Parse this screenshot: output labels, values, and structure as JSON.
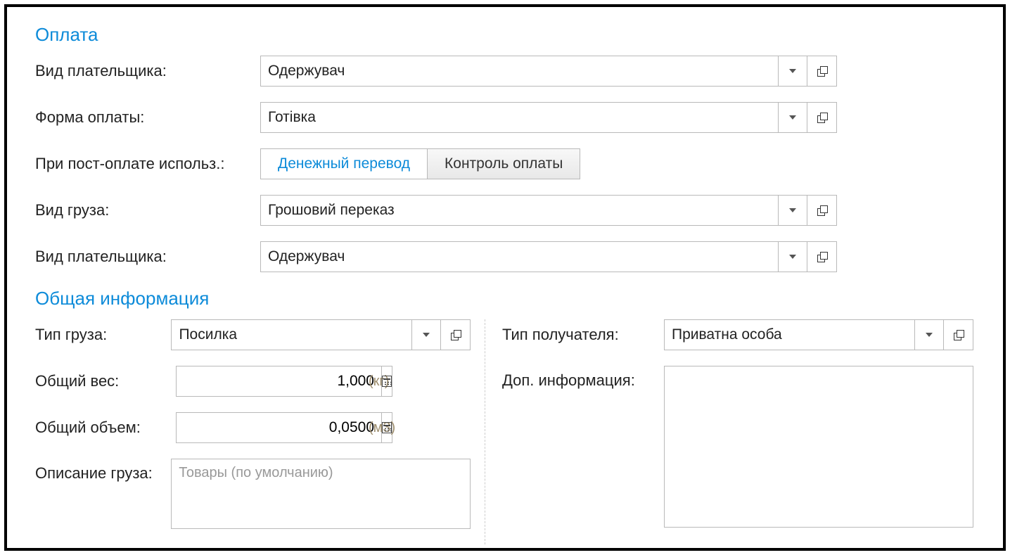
{
  "payment": {
    "title": "Оплата",
    "payer_type_label": "Вид плательщика:",
    "payer_type_value": "Одержувач",
    "payment_form_label": "Форма оплаты:",
    "payment_form_value": "Готівка",
    "post_payment_label": "При пост-оплате использ.:",
    "toggle_money_transfer": "Денежный перевод",
    "toggle_payment_control": "Контроль оплаты",
    "cargo_kind_label": "Вид груза:",
    "cargo_kind_value": "Грошовий переказ",
    "payer_type2_label": "Вид плательщика:",
    "payer_type2_value": "Одержувач"
  },
  "general": {
    "title": "Общая информация",
    "cargo_type_label": "Тип груза:",
    "cargo_type_value": "Посилка",
    "weight_label": "Общий вес:",
    "weight_value": "1,000",
    "weight_unit": "(кг)",
    "volume_label": "Общий объем:",
    "volume_value": "0,0500",
    "volume_unit": "(м3)",
    "description_label": "Описание груза:",
    "description_placeholder": "Товары (по умолчанию)",
    "recipient_type_label": "Тип получателя:",
    "recipient_type_value": "Приватна особа",
    "extra_info_label": "Доп. информация:"
  }
}
